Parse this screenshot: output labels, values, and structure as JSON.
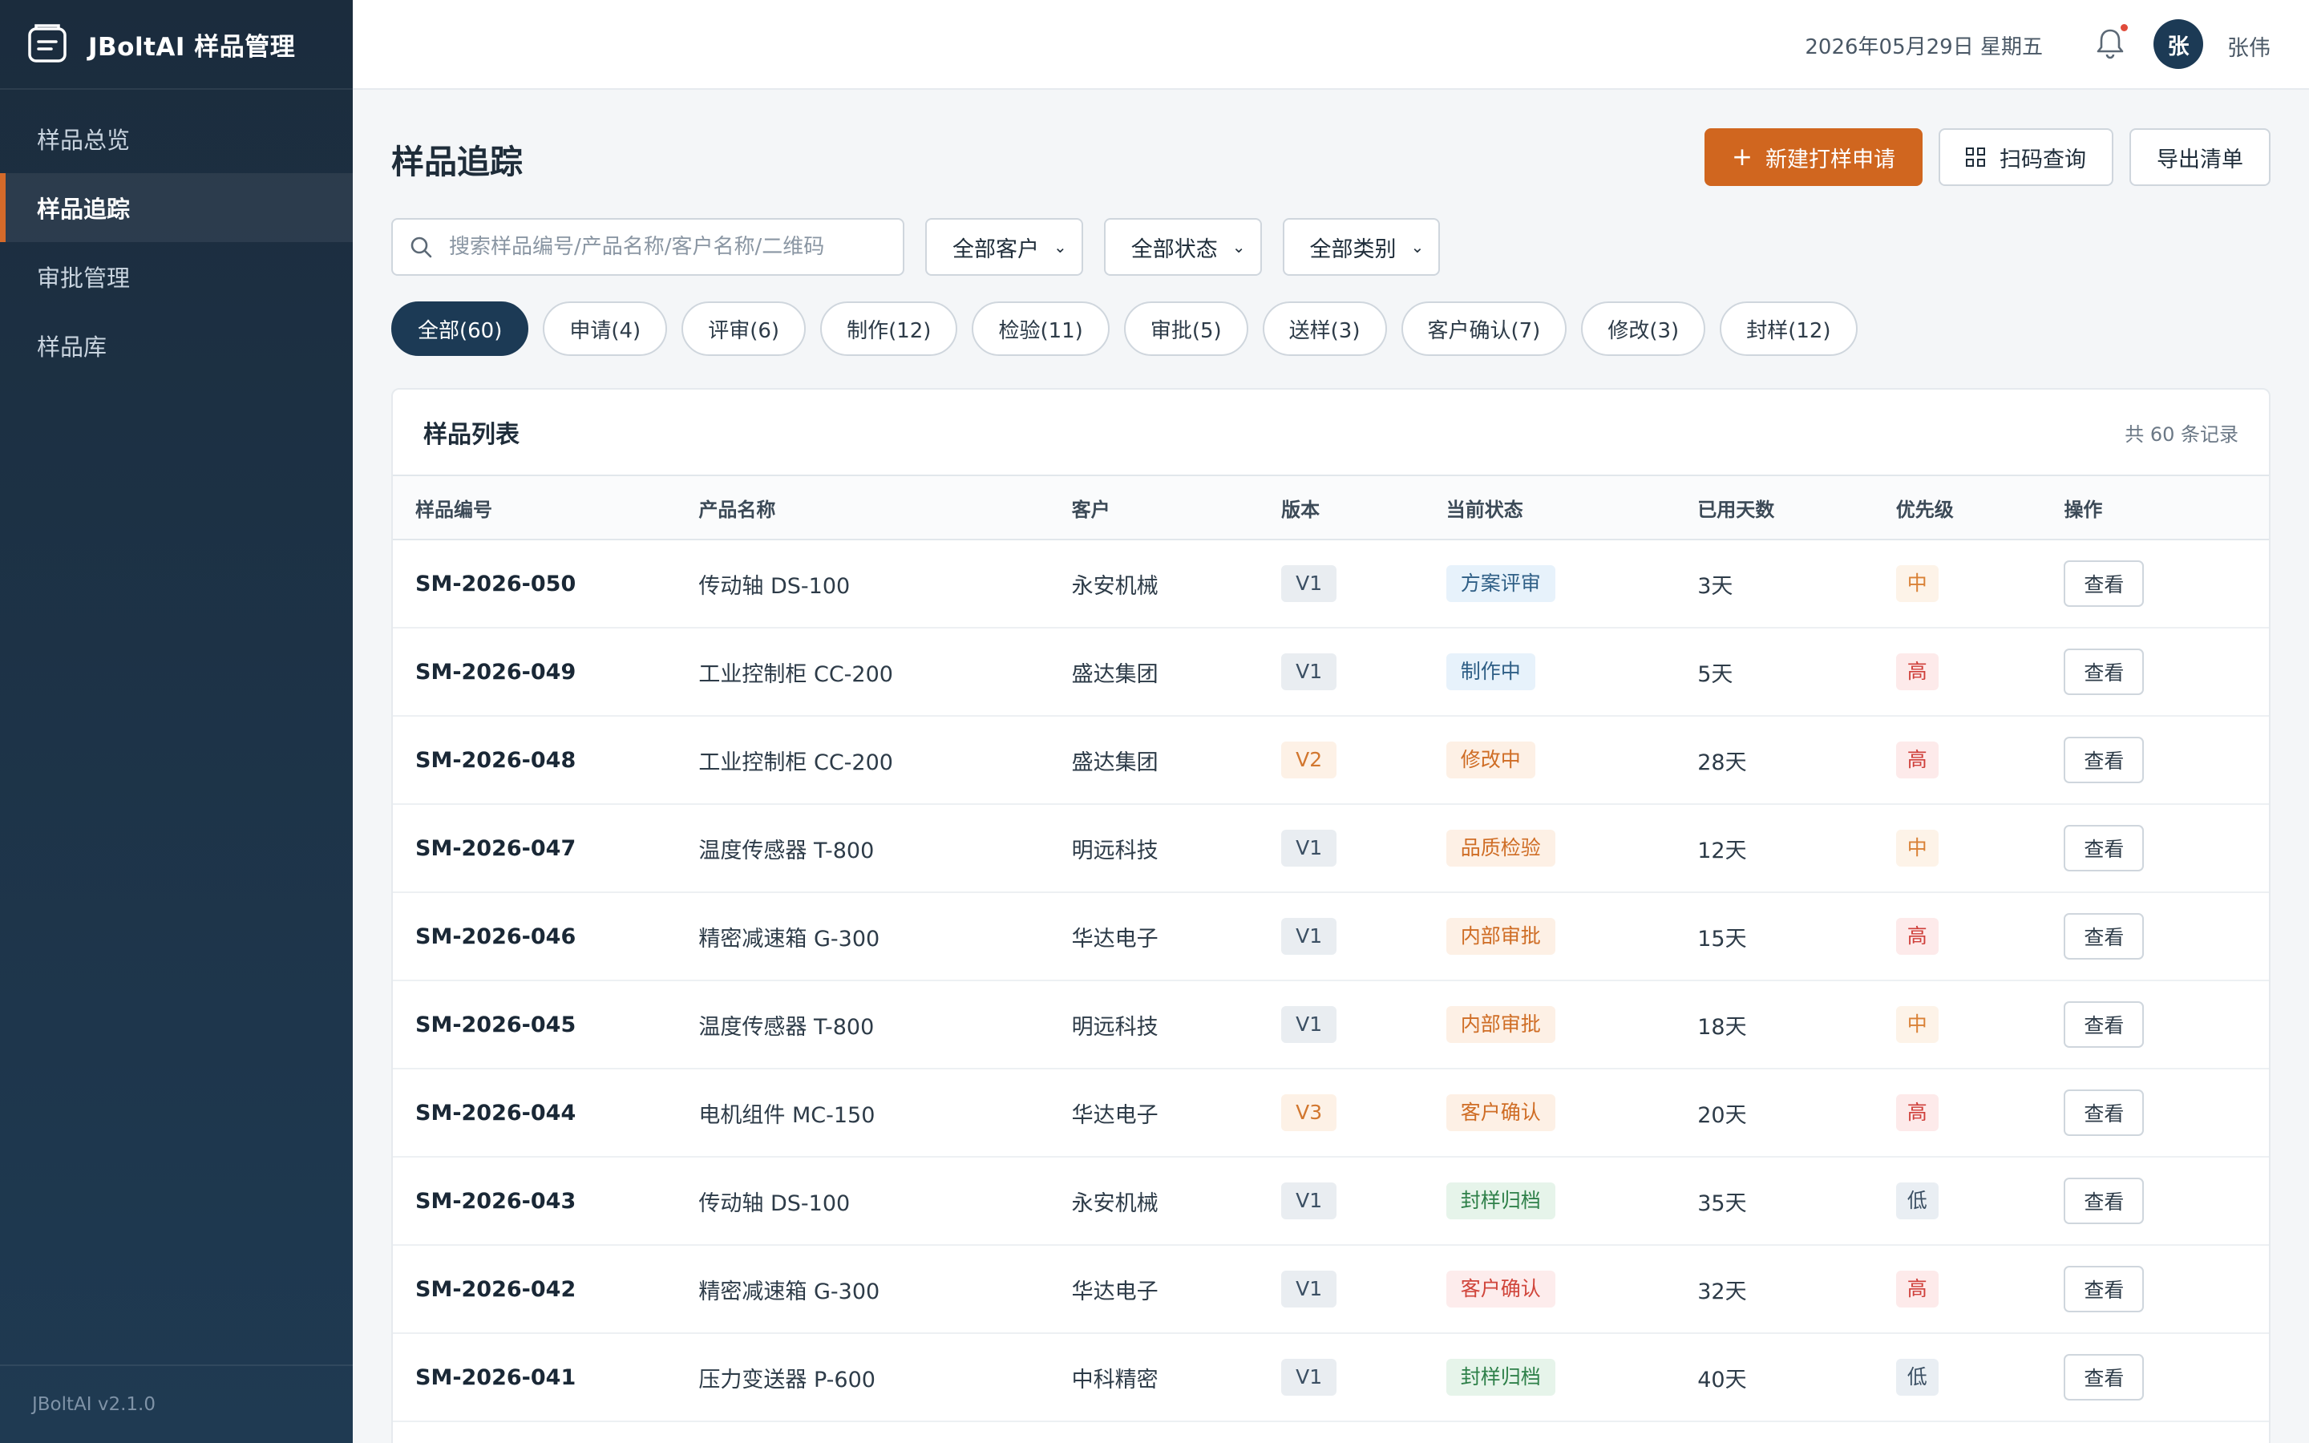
{
  "app": {
    "title": "JBoltAI 样品管理",
    "version": "JBoltAI v2.1.0"
  },
  "sidebar": {
    "items": [
      {
        "label": "样品总览",
        "active": false
      },
      {
        "label": "样品追踪",
        "active": true
      },
      {
        "label": "审批管理",
        "active": false
      },
      {
        "label": "样品库",
        "active": false
      }
    ]
  },
  "header": {
    "date": "2026年05月29日 星期五",
    "user_initial": "张",
    "user_name": "张伟",
    "has_notification": true
  },
  "page": {
    "title": "样品追踪",
    "actions": {
      "new_label": "新建打样申请",
      "scan_label": "扫码查询",
      "export_label": "导出清单"
    }
  },
  "filters": {
    "search_placeholder": "搜索样品编号/产品名称/客户名称/二维码",
    "search_value": "",
    "customer": "全部客户",
    "status": "全部状态",
    "category": "全部类别"
  },
  "chips": [
    {
      "label": "全部(60)",
      "active": true
    },
    {
      "label": "申请(4)",
      "active": false
    },
    {
      "label": "评审(6)",
      "active": false
    },
    {
      "label": "制作(12)",
      "active": false
    },
    {
      "label": "检验(11)",
      "active": false
    },
    {
      "label": "审批(5)",
      "active": false
    },
    {
      "label": "送样(3)",
      "active": false
    },
    {
      "label": "客户确认(7)",
      "active": false
    },
    {
      "label": "修改(3)",
      "active": false
    },
    {
      "label": "封样(12)",
      "active": false
    }
  ],
  "table": {
    "title": "样品列表",
    "record_count": "共 60 条记录",
    "columns": [
      "样品编号",
      "产品名称",
      "客户",
      "版本",
      "当前状态",
      "已用天数",
      "优先级",
      "操作"
    ],
    "view_label": "查看",
    "rows": [
      {
        "id": "SM-2026-050",
        "product": "传动轴 DS-100",
        "customer": "永安机械",
        "version": "V1",
        "version_style": "gray",
        "status": "方案评审",
        "status_style": "blue",
        "days": "3天",
        "priority": "中",
        "priority_style": "mid"
      },
      {
        "id": "SM-2026-049",
        "product": "工业控制柜 CC-200",
        "customer": "盛达集团",
        "version": "V1",
        "version_style": "gray",
        "status": "制作中",
        "status_style": "blue",
        "days": "5天",
        "priority": "高",
        "priority_style": "high"
      },
      {
        "id": "SM-2026-048",
        "product": "工业控制柜 CC-200",
        "customer": "盛达集团",
        "version": "V2",
        "version_style": "orange",
        "status": "修改中",
        "status_style": "orange",
        "days": "28天",
        "priority": "高",
        "priority_style": "high"
      },
      {
        "id": "SM-2026-047",
        "product": "温度传感器 T-800",
        "customer": "明远科技",
        "version": "V1",
        "version_style": "gray",
        "status": "品质检验",
        "status_style": "orange",
        "days": "12天",
        "priority": "中",
        "priority_style": "mid"
      },
      {
        "id": "SM-2026-046",
        "product": "精密减速箱 G-300",
        "customer": "华达电子",
        "version": "V1",
        "version_style": "gray",
        "status": "内部审批",
        "status_style": "orange",
        "days": "15天",
        "priority": "高",
        "priority_style": "high"
      },
      {
        "id": "SM-2026-045",
        "product": "温度传感器 T-800",
        "customer": "明远科技",
        "version": "V1",
        "version_style": "gray",
        "status": "内部审批",
        "status_style": "orange",
        "days": "18天",
        "priority": "中",
        "priority_style": "mid"
      },
      {
        "id": "SM-2026-044",
        "product": "电机组件 MC-150",
        "customer": "华达电子",
        "version": "V3",
        "version_style": "orange",
        "status": "客户确认",
        "status_style": "orange",
        "days": "20天",
        "priority": "高",
        "priority_style": "high"
      },
      {
        "id": "SM-2026-043",
        "product": "传动轴 DS-100",
        "customer": "永安机械",
        "version": "V1",
        "version_style": "gray",
        "status": "封样归档",
        "status_style": "green",
        "days": "35天",
        "priority": "低",
        "priority_style": "low"
      },
      {
        "id": "SM-2026-042",
        "product": "精密减速箱 G-300",
        "customer": "华达电子",
        "version": "V1",
        "version_style": "gray",
        "status": "客户确认",
        "status_style": "red",
        "days": "32天",
        "priority": "高",
        "priority_style": "high"
      },
      {
        "id": "SM-2026-041",
        "product": "压力变送器 P-600",
        "customer": "中科精密",
        "version": "V1",
        "version_style": "gray",
        "status": "封样归档",
        "status_style": "green",
        "days": "40天",
        "priority": "低",
        "priority_style": "low"
      }
    ]
  },
  "colors": {
    "brand_orange": "#d0661f",
    "navy": "#1c3a55",
    "sidebar_dark": "#1b2c3d"
  }
}
